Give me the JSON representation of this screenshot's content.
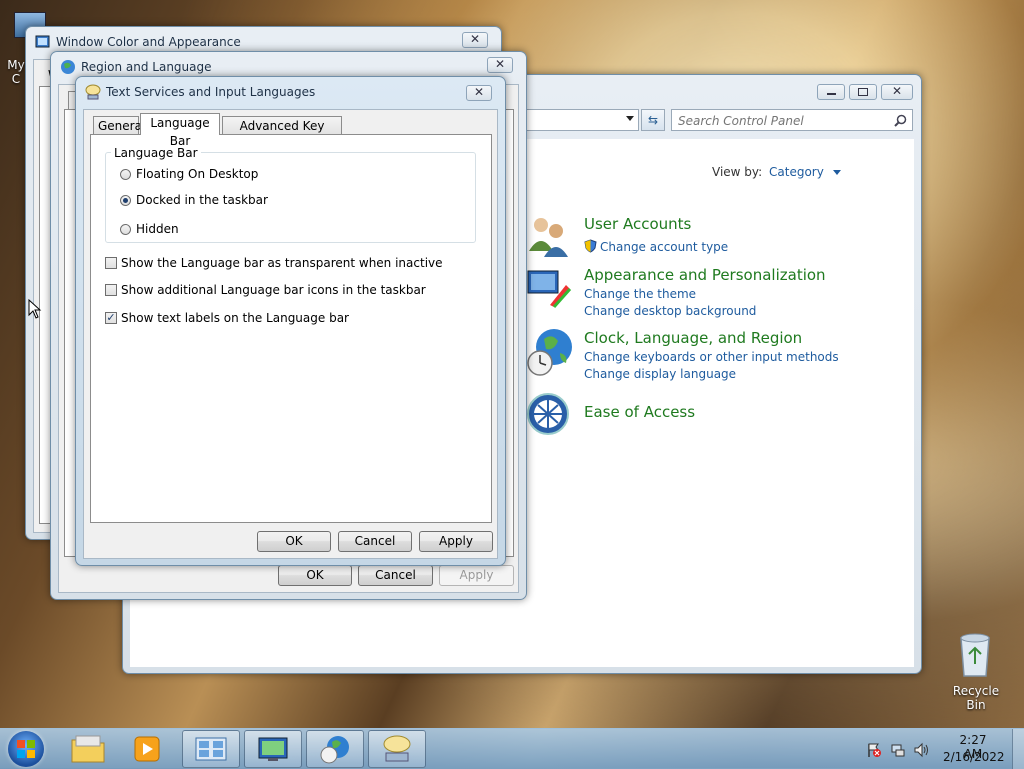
{
  "desktop": {
    "my_computer_label": "My C",
    "recycle_bin_label": "Recycle Bin"
  },
  "window_color": {
    "title": "Window Color and Appearance",
    "partial_text": "W"
  },
  "region": {
    "title": "Region and Language",
    "ok": "OK",
    "cancel": "Cancel",
    "apply": "Apply"
  },
  "control_panel": {
    "search_placeholder": "Search Control Panel",
    "view_by_label": "View by:",
    "view_by_value": "Category",
    "categories": [
      {
        "title": "User Accounts",
        "links": [
          "Change account type"
        ]
      },
      {
        "title": "Appearance and Personalization",
        "links": [
          "Change the theme",
          "Change desktop background"
        ]
      },
      {
        "title": "Clock, Language, and Region",
        "links": [
          "Change keyboards or other input methods",
          "Change display language"
        ]
      },
      {
        "title": "Ease of Access",
        "links": []
      }
    ]
  },
  "tsil": {
    "title": "Text Services and Input Languages",
    "tabs": [
      "General",
      "Language Bar",
      "Advanced Key Settings"
    ],
    "group_label": "Language Bar",
    "radios": [
      "Floating On Desktop",
      "Docked in the taskbar",
      "Hidden"
    ],
    "selected_radio": 1,
    "checks": [
      {
        "label": "Show the Language bar as transparent when inactive",
        "checked": false
      },
      {
        "label": "Show additional Language bar icons in the taskbar",
        "checked": false
      },
      {
        "label": "Show text labels on the Language bar",
        "checked": true
      }
    ],
    "ok": "OK",
    "cancel": "Cancel",
    "apply": "Apply"
  },
  "taskbar": {
    "time": "2:27 AM",
    "date": "2/16/2022",
    "close_glyph": "✕",
    "check_glyph": "✓"
  },
  "colors": {
    "link": "#1e5b9e",
    "category": "#1f7a1f"
  }
}
